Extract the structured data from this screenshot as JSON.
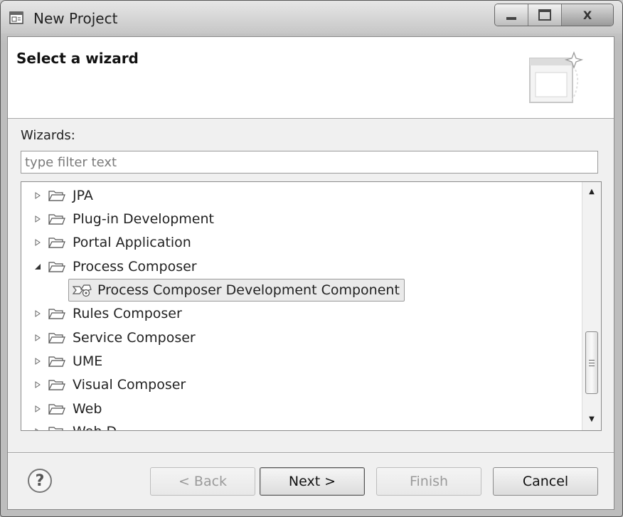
{
  "window": {
    "title": "New Project"
  },
  "caption_buttons": {
    "close_glyph": "X"
  },
  "banner": {
    "title": "Select a wizard"
  },
  "wizards": {
    "label": "Wizards:",
    "filter_placeholder": "type filter text",
    "tree": [
      {
        "label": "JPA",
        "expanded": false
      },
      {
        "label": "Plug-in Development",
        "expanded": false
      },
      {
        "label": "Portal Application",
        "expanded": false
      },
      {
        "label": "Process Composer",
        "expanded": true,
        "children": [
          {
            "label": "Process Composer Development Component",
            "selected": true
          }
        ]
      },
      {
        "label": "Rules Composer",
        "expanded": false
      },
      {
        "label": "Service Composer",
        "expanded": false
      },
      {
        "label": "UME",
        "expanded": false
      },
      {
        "label": "Visual Composer",
        "expanded": false
      },
      {
        "label": "Web",
        "expanded": false
      },
      {
        "label": "Web D",
        "expanded": false
      }
    ]
  },
  "buttons": {
    "help": "?",
    "back": "< Back",
    "next": "Next >",
    "finish": "Finish",
    "cancel": "Cancel"
  },
  "colors": {
    "selection_bg": "#eaeaea",
    "window_frame": "#bdbdbd"
  }
}
